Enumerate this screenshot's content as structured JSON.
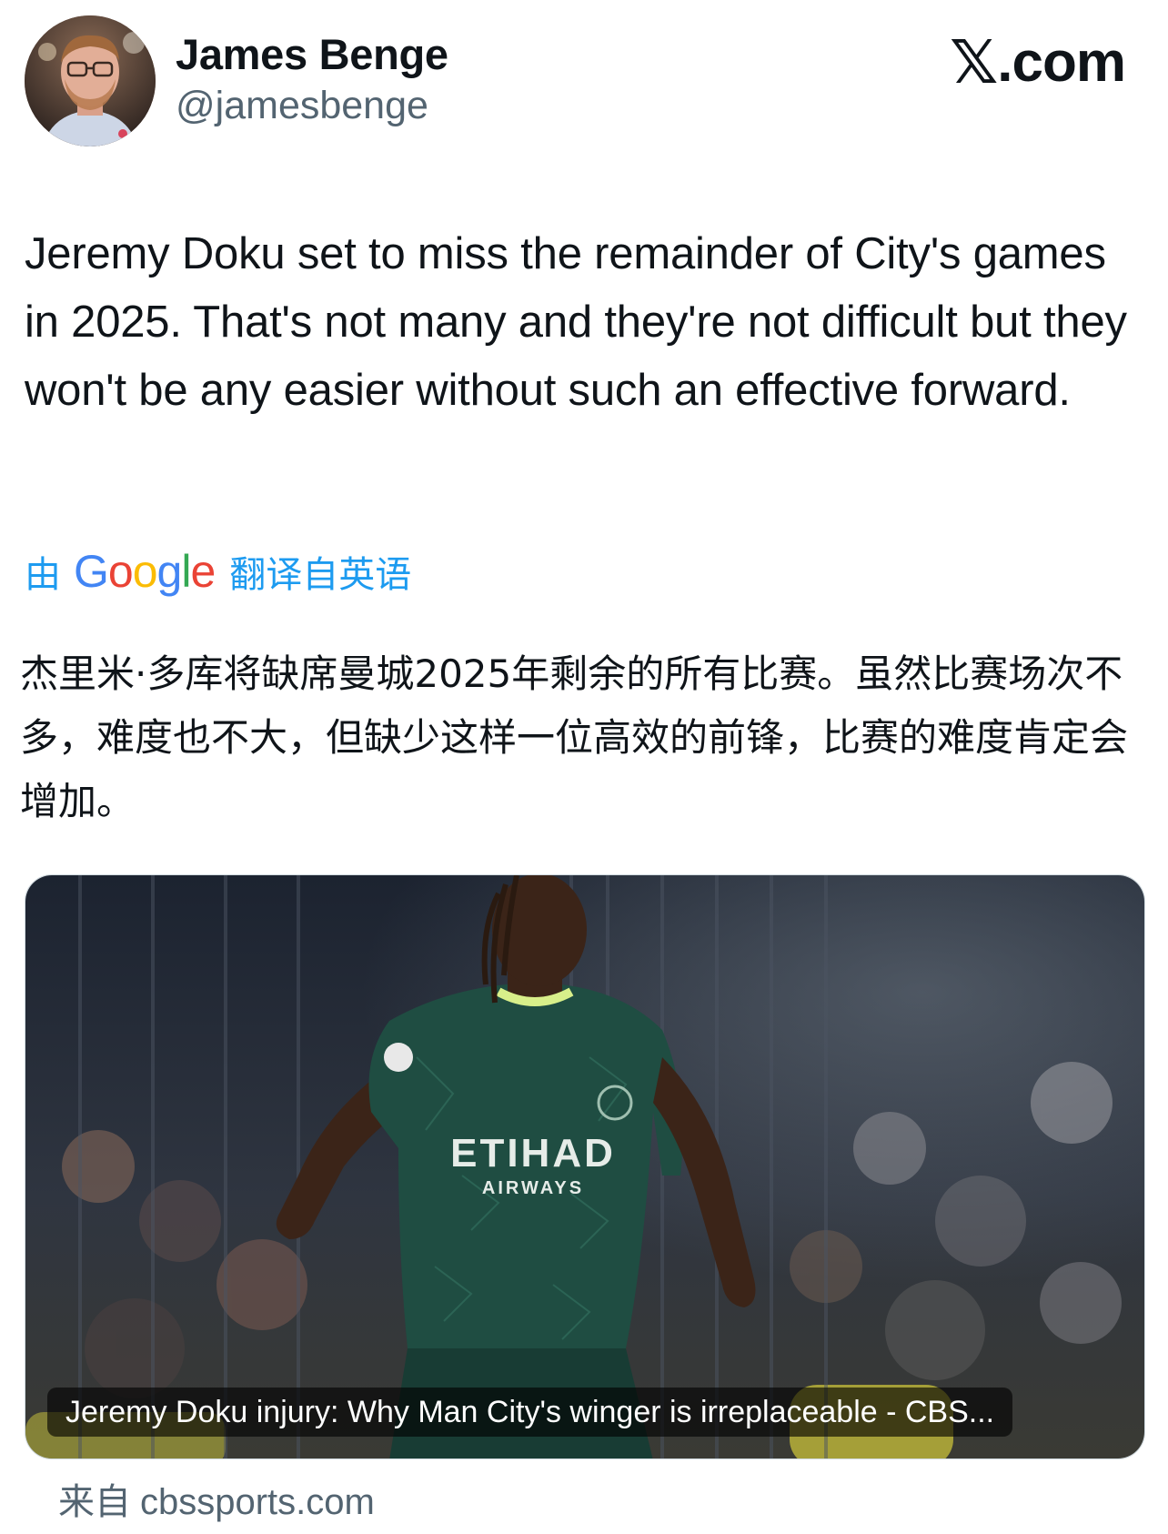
{
  "author": {
    "name": "James Benge",
    "handle": "@jamesbenge"
  },
  "brand": {
    "glyph": "𝕏",
    "domain": ".com"
  },
  "tweet": {
    "text": "Jeremy Doku set to miss the remainder of City's games in 2025. That's not many and they're not difficult but they won't be any easier without such an effective forward."
  },
  "translation": {
    "prefix": "由",
    "provider": "Google",
    "suffix": "翻译自英语",
    "text": "杰里米·多库将缺席曼城2025年剩余的所有比赛。虽然比赛场次不多，难度也不大，但缺少这样一位高效的前锋，比赛的难度肯定会增加。"
  },
  "link_card": {
    "caption": "Jeremy Doku injury: Why Man City's winger is irreplaceable - CBS...",
    "shirt_sponsor": "ETIHAD",
    "shirt_sponsor_sub": "AIRWAYS"
  },
  "source": {
    "prefix": "来自",
    "domain": "cbssports.com"
  },
  "colors": {
    "link_blue": "#1d9bf0",
    "muted_gray": "#536471",
    "text": "#0f1419",
    "jersey_green": "#1f4d42",
    "collar_lime": "#d8ef8a"
  },
  "icons": {
    "avatar": "profile-photo",
    "brand": "x-logo"
  }
}
